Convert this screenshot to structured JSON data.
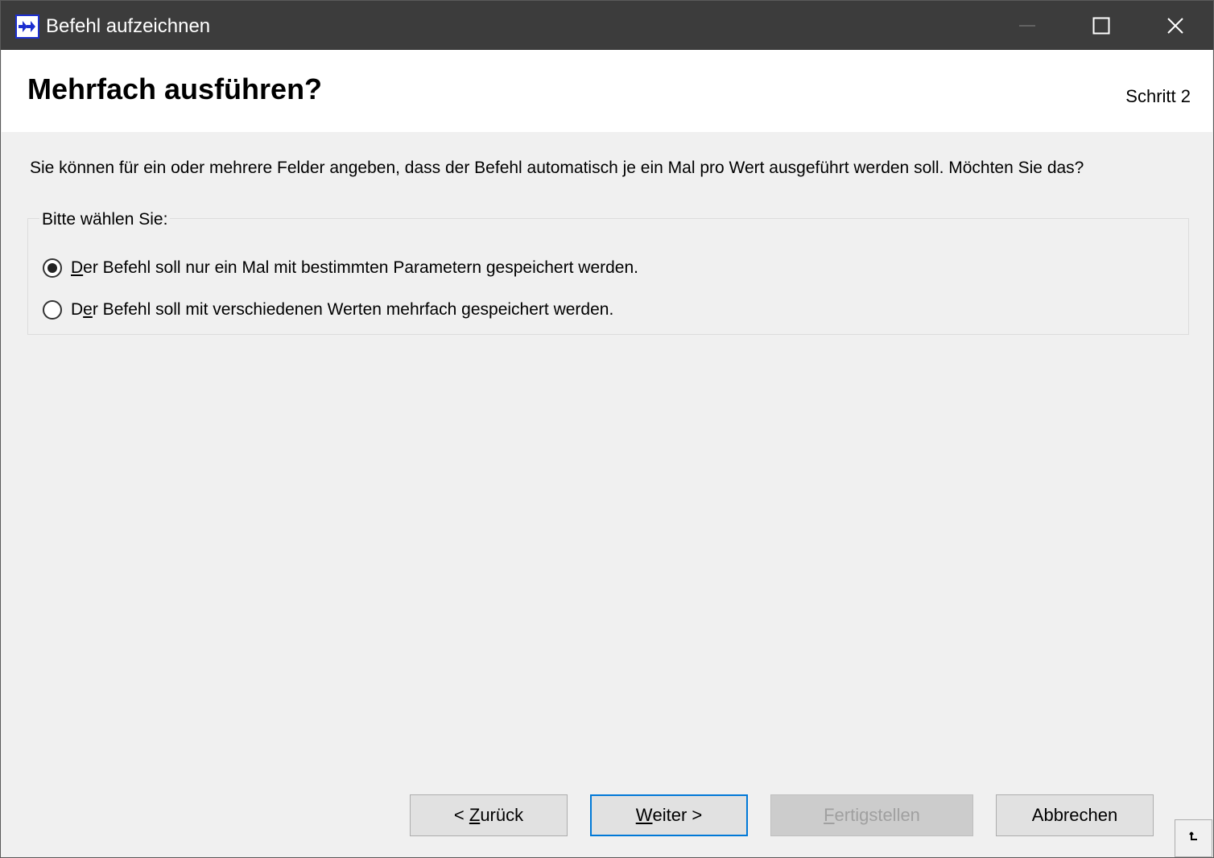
{
  "window": {
    "title": "Befehl aufzeichnen"
  },
  "header": {
    "title": "Mehrfach ausführen?",
    "step": "Schritt 2"
  },
  "main": {
    "description": "Sie können für ein oder mehrere Felder angeben, dass der Befehl automatisch je ein Mal pro Wert ausgeführt werden soll. Möchten Sie das?",
    "group_label": "Bitte wählen Sie:",
    "options": [
      {
        "mnemonic": "D",
        "rest": "er Befehl soll nur ein Mal mit bestimmten Parametern gespeichert werden.",
        "selected": true
      },
      {
        "prefix": "D",
        "mnemonic": "e",
        "rest": "r Befehl soll mit verschiedenen Werten mehrfach gespeichert werden.",
        "selected": false
      }
    ]
  },
  "buttons": {
    "back": {
      "prefix": "< ",
      "mnemonic": "Z",
      "rest": "urück"
    },
    "next": {
      "mnemonic": "W",
      "rest": "eiter >"
    },
    "finish": {
      "mnemonic": "F",
      "rest": "ertigstellen",
      "enabled": false
    },
    "cancel": {
      "label": "Abbrechen"
    }
  },
  "icons": {
    "app": "double-arrow-right-icon",
    "minimize": "minimize-icon",
    "maximize": "maximize-icon",
    "close": "close-icon",
    "grip": "size-grip-icon"
  },
  "colors": {
    "titlebar": "#3c3c3c",
    "accent": "#0078d7",
    "app_icon": "#1c2fd0"
  }
}
